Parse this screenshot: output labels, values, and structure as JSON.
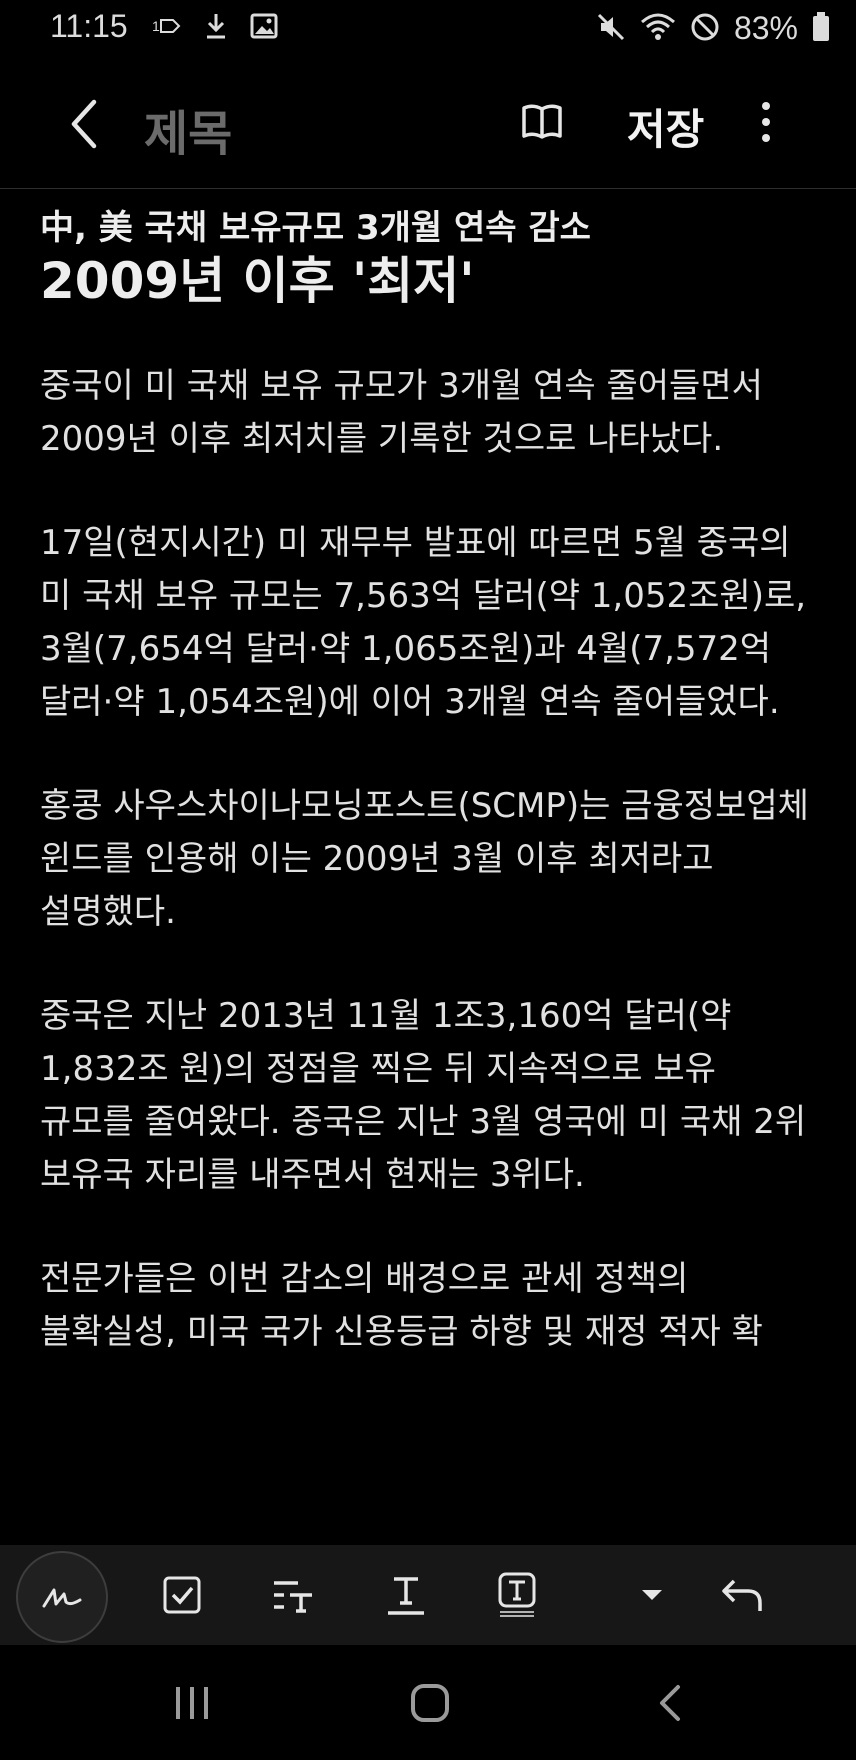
{
  "status": {
    "time": "11:15",
    "battery": "83%",
    "icons": [
      "dual-sim-icon",
      "download-icon",
      "gallery-icon",
      "mute-icon",
      "wifi-icon",
      "do-not-disturb-icon",
      "battery-icon"
    ]
  },
  "header": {
    "title_placeholder": "제목",
    "save_label": "저장"
  },
  "article": {
    "subtitle": "中, 美 국채 보유규모 3개월 연속 감소",
    "headline": "2009년 이후 '최저'",
    "paragraphs": [
      "중국이 미 국채 보유 규모가 3개월 연속 줄어들면서 2009년 이후 최저치를 기록한 것으로 나타났다.",
      "17일(현지시간) 미 재무부 발표에 따르면 5월 중국의 미 국채 보유 규모는 7,563억 달러(약 1,052조원)로, 3월(7,654억 달러·약 1,065조원)과 4월(7,572억 달러·약 1,054조원)에 이어 3개월 연속 줄어들었다.",
      "홍콩 사우스차이나모닝포스트(SCMP)는 금융정보업체 윈드를 인용해 이는 2009년 3월 이후 최저라고 설명했다.",
      "중국은 지난 2013년 11월 1조3,160억 달러(약 1,832조 원)의 정점을 찍은 뒤 지속적으로 보유 규모를 줄여왔다. 중국은 지난 3월 영국에 미 국채 2위 보유국 자리를 내주면서 현재는 3위다.",
      "전문가들은 이번 감소의 배경으로 관세 정책의 불확실성, 미국 국가 신용등급 하향 및 재정 적자 확"
    ]
  },
  "toolbar": {
    "tools": [
      "handwriting-icon",
      "checkbox-icon",
      "text-style-icon",
      "text-format-icon",
      "text-box-icon",
      "dropdown-icon",
      "undo-icon"
    ]
  },
  "navbar": {
    "buttons": [
      "recent-apps",
      "home",
      "back"
    ]
  }
}
